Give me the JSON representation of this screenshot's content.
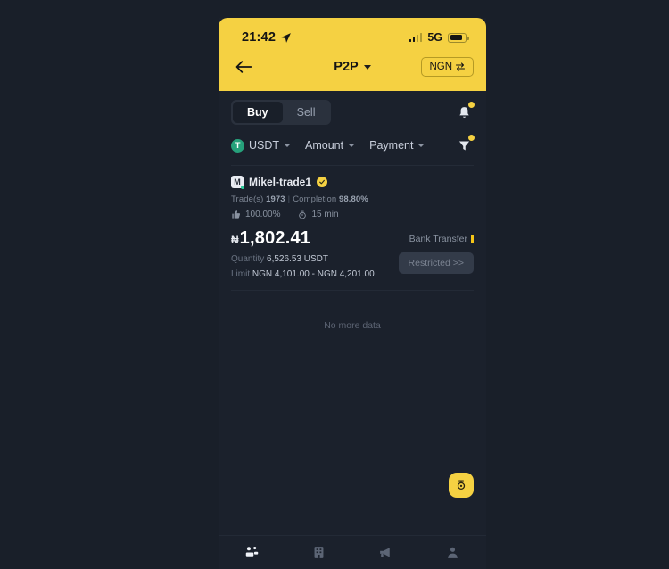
{
  "statusbar": {
    "time": "21:42",
    "location_icon": "location-arrow-icon",
    "signal_icon": "signal-bars-icon",
    "network": "5G",
    "battery_icon": "battery-icon"
  },
  "navbar": {
    "back_icon": "back-arrow-icon",
    "title": "P2P",
    "title_caret_icon": "chevron-down-icon",
    "currency_label": "NGN",
    "currency_swap_icon": "swap-icon"
  },
  "tabs": {
    "buy_label": "Buy",
    "sell_label": "Sell",
    "active": "Buy",
    "notification_icon": "bell-icon"
  },
  "filters": {
    "asset": "USDT",
    "asset_icon": "usdt-coin-icon",
    "amount_label": "Amount",
    "payment_label": "Payment",
    "caret_icon": "chevron-down-icon",
    "filter_icon": "funnel-icon"
  },
  "offer": {
    "avatar_letter": "M",
    "merchant_name": "Mikel-trade1",
    "verified_icon": "verified-check-icon",
    "trades_label": "Trade(s)",
    "trades_count": "1973",
    "divider": "|",
    "completion_label": "Completion",
    "completion_value": "98.80%",
    "thumbs_icon": "thumbs-up-icon",
    "positive_rate": "100.00%",
    "clock_icon": "stopwatch-icon",
    "release_time": "15 min",
    "currency_symbol": "₦",
    "price": "1,802.41",
    "quantity_label": "Quantity",
    "quantity_value": "6,526.53 USDT",
    "limit_label": "Limit",
    "limit_value": "NGN 4,101.00 - NGN 4,201.00",
    "payment_method": "Bank Transfer",
    "action_label": "Restricted >>"
  },
  "list": {
    "empty_text": "No more data"
  },
  "fab": {
    "icon": "coin-stack-icon"
  },
  "bottomnav": {
    "items": [
      {
        "icon": "p2p-people-icon",
        "active": true
      },
      {
        "icon": "building-icon",
        "active": false
      },
      {
        "icon": "megaphone-icon",
        "active": false
      },
      {
        "icon": "profile-icon",
        "active": false
      }
    ]
  },
  "colors": {
    "brand_yellow": "#f5d142",
    "page_bg": "#191f29",
    "card_bg": "#1b212c",
    "usdt_green": "#26a17b"
  }
}
